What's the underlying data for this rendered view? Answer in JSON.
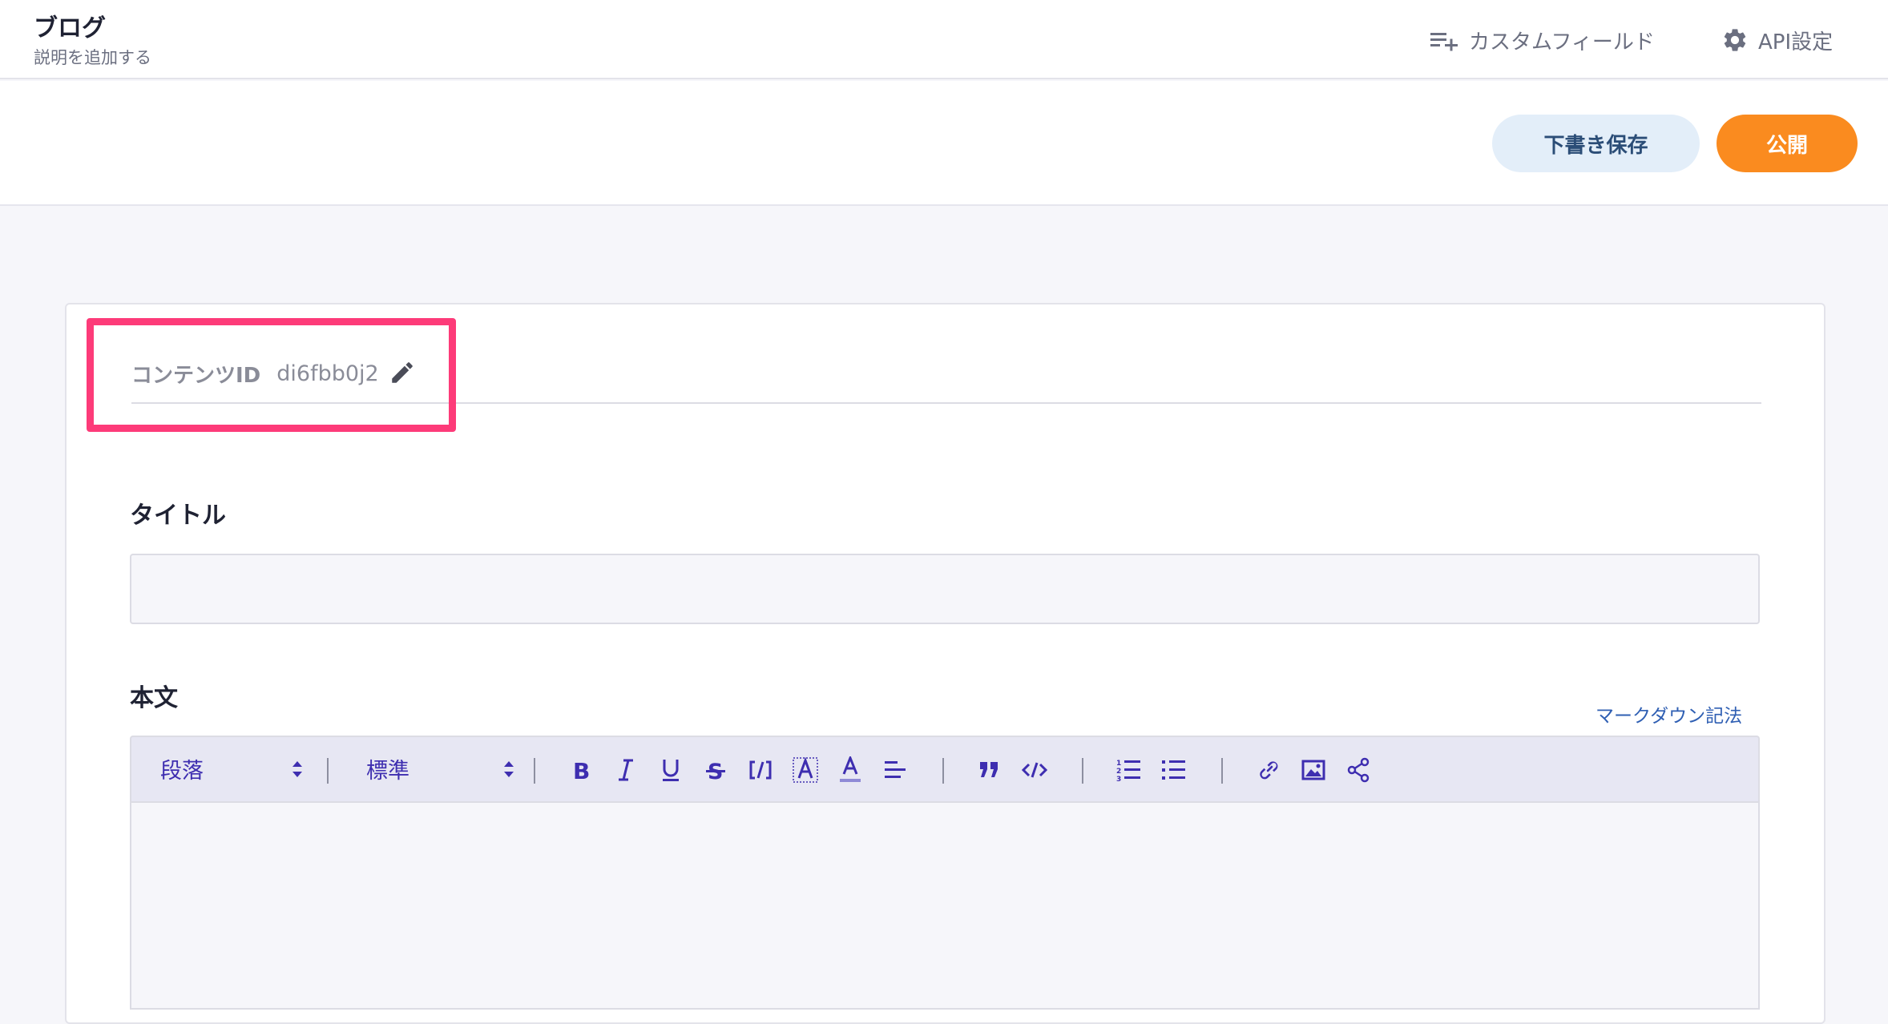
{
  "header": {
    "title": "ブログ",
    "description": "説明を追加する",
    "custom_field_label": "カスタムフィールド",
    "api_settings_label": "API設定"
  },
  "actions": {
    "draft_label": "下書き保存",
    "publish_label": "公開"
  },
  "content_id": {
    "label": "コンテンツID",
    "value": "di6fbb0j2"
  },
  "fields": {
    "title_label": "タイトル",
    "title_value": "",
    "body_label": "本文",
    "markdown_link": "マークダウン記法"
  },
  "toolbar": {
    "paragraph_select": "段落",
    "size_select": "標準",
    "buttons": [
      "bold-icon",
      "italic-icon",
      "underline-icon",
      "strikethrough-icon",
      "inline-code-icon",
      "highlight-icon",
      "text-color-icon",
      "align-icon",
      "blockquote-icon",
      "code-block-icon",
      "ordered-list-icon",
      "bullet-list-icon",
      "link-icon",
      "image-icon",
      "embed-icon"
    ]
  },
  "colors": {
    "accent": "#3e2eb0",
    "publish": "#fa8b1f",
    "draft_bg": "#e3eef9",
    "highlight": "#fd3b79"
  }
}
